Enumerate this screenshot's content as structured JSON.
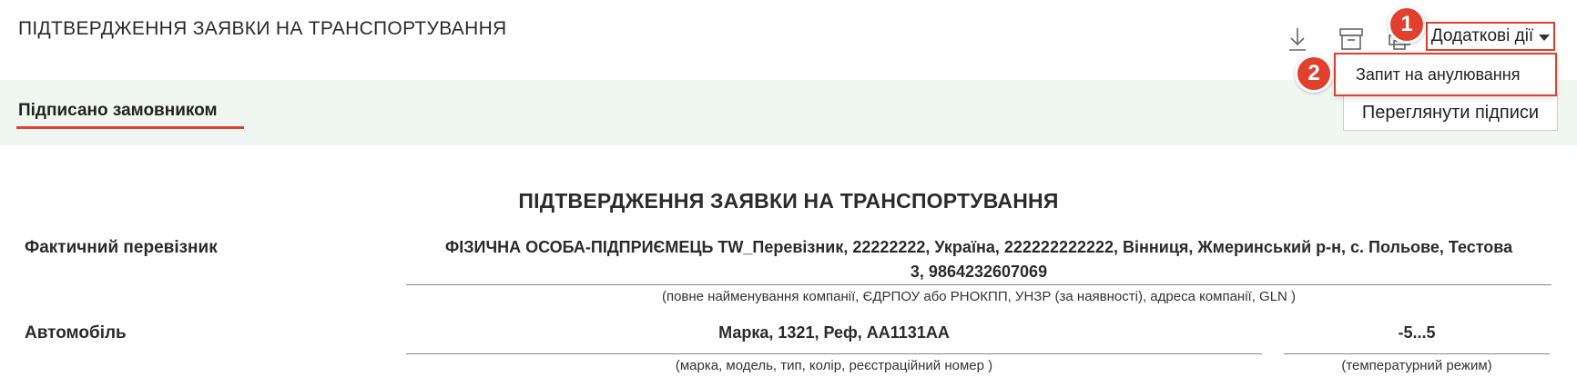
{
  "header": {
    "title": "ПІДТВЕРДЖЕННЯ ЗАЯВКИ НА ТРАНСПОРТУВАННЯ",
    "icons": [
      "download-icon",
      "archive-icon",
      "print-icon"
    ],
    "more_actions_label": "Додаткові дії"
  },
  "dropdown": {
    "items": [
      {
        "label": "Запит на анулювання"
      }
    ]
  },
  "badges": [
    "1",
    "2"
  ],
  "status": {
    "label": "Підписано замовником",
    "view_signatures_label": "Переглянути підписи"
  },
  "document": {
    "title": "ПІДТВЕРДЖЕННЯ ЗАЯВКИ НА ТРАНСПОРТУВАННЯ",
    "carrier": {
      "label": "Фактичний перевізник",
      "value_line1": "ФІЗИЧНА ОСОБА-ПІДПРИЄМЕЦЬ TW_Перевізник, 22222222, Україна, 222222222222, Вінниця, Жмеринський р-н, с. Польове, Тестова",
      "value_line2": "3, 9864232607069",
      "hint": "(повне найменування компанії, ЄДРПОУ або РНОКПП, УНЗР (за наявності), адреса компанії, GLN )"
    },
    "vehicle": {
      "label": "Автомобіль",
      "value": "Марка, 1321, Реф, АА1131АА",
      "hint": "(марка, модель, тип, колір, реєстраційний номер )",
      "temperature_value": "-5...5",
      "temperature_hint": "(температурний режим)"
    }
  },
  "colors": {
    "accent": "#e0412e",
    "status_band": "#f0f7f2"
  }
}
